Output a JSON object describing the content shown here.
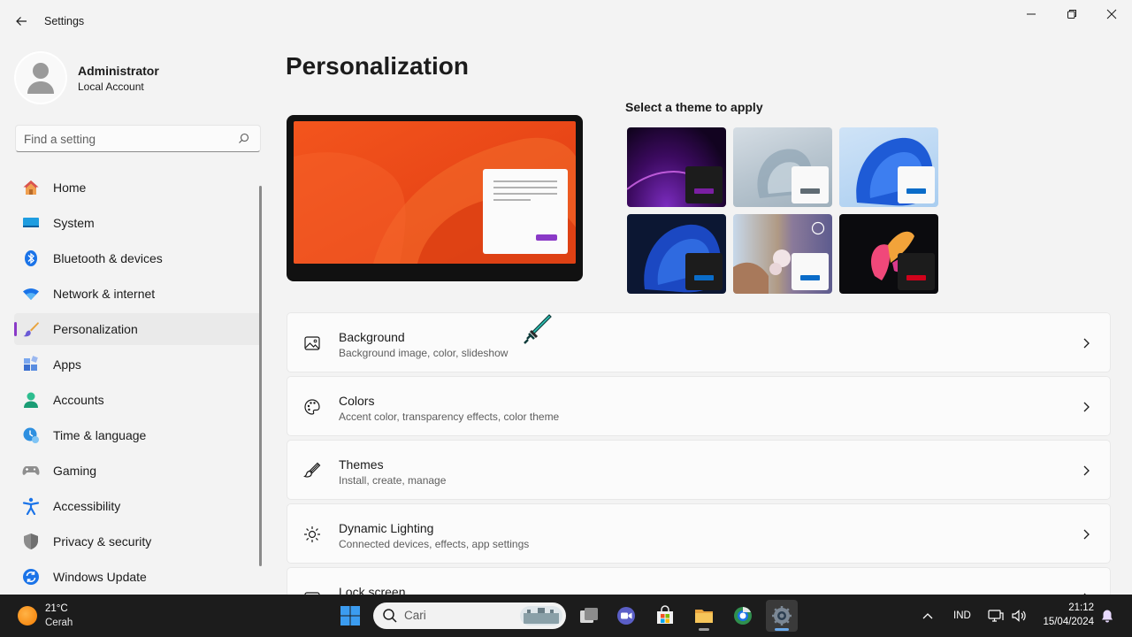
{
  "window": {
    "title": "Settings",
    "minimize_icon": "minimize-icon",
    "maximize_icon": "restore-icon",
    "close_icon": "close-icon"
  },
  "profile": {
    "name": "Administrator",
    "account_type": "Local Account"
  },
  "search": {
    "placeholder": "Find a setting"
  },
  "sidebar": {
    "items": [
      {
        "label": "Home",
        "icon": "home-icon"
      },
      {
        "label": "System",
        "icon": "system-icon"
      },
      {
        "label": "Bluetooth & devices",
        "icon": "bluetooth-icon"
      },
      {
        "label": "Network & internet",
        "icon": "wifi-icon"
      },
      {
        "label": "Personalization",
        "icon": "brush-icon",
        "active": true
      },
      {
        "label": "Apps",
        "icon": "apps-icon"
      },
      {
        "label": "Accounts",
        "icon": "accounts-icon"
      },
      {
        "label": "Time & language",
        "icon": "clock-globe-icon"
      },
      {
        "label": "Gaming",
        "icon": "gamepad-icon"
      },
      {
        "label": "Accessibility",
        "icon": "accessibility-icon"
      },
      {
        "label": "Privacy & security",
        "icon": "shield-icon"
      },
      {
        "label": "Windows Update",
        "icon": "update-icon"
      }
    ]
  },
  "main": {
    "title": "Personalization",
    "theme_section_label": "Select a theme to apply",
    "themes": [
      {
        "name": "theme-1",
        "accent": "#7a1fa2"
      },
      {
        "name": "theme-2",
        "accent": "#5f6b73"
      },
      {
        "name": "theme-3",
        "accent": "#0a6cc9"
      },
      {
        "name": "theme-4",
        "accent": "#0a6cc9"
      },
      {
        "name": "theme-5",
        "accent": "#0a6cc9"
      },
      {
        "name": "theme-6",
        "accent": "#d0021b"
      }
    ],
    "cards": [
      {
        "title": "Background",
        "subtitle": "Background image, color, slideshow",
        "icon": "image-icon"
      },
      {
        "title": "Colors",
        "subtitle": "Accent color, transparency effects, color theme",
        "icon": "palette-icon"
      },
      {
        "title": "Themes",
        "subtitle": "Install, create, manage",
        "icon": "brush-icon"
      },
      {
        "title": "Dynamic Lighting",
        "subtitle": "Connected devices, effects, app settings",
        "icon": "lighting-icon"
      },
      {
        "title": "Lock screen",
        "subtitle": "",
        "icon": "lock-screen-icon"
      }
    ]
  },
  "taskbar": {
    "weather": {
      "temp": "21°C",
      "condition": "Cerah"
    },
    "search_label": "Cari",
    "language": "IND",
    "time": "21:12",
    "date": "15/04/2024"
  },
  "colors": {
    "accent": "#8a3ac7",
    "window_bg": "#f3f3f3",
    "card_bg": "#fbfbfb",
    "taskbar_bg": "#1c1c1c"
  }
}
